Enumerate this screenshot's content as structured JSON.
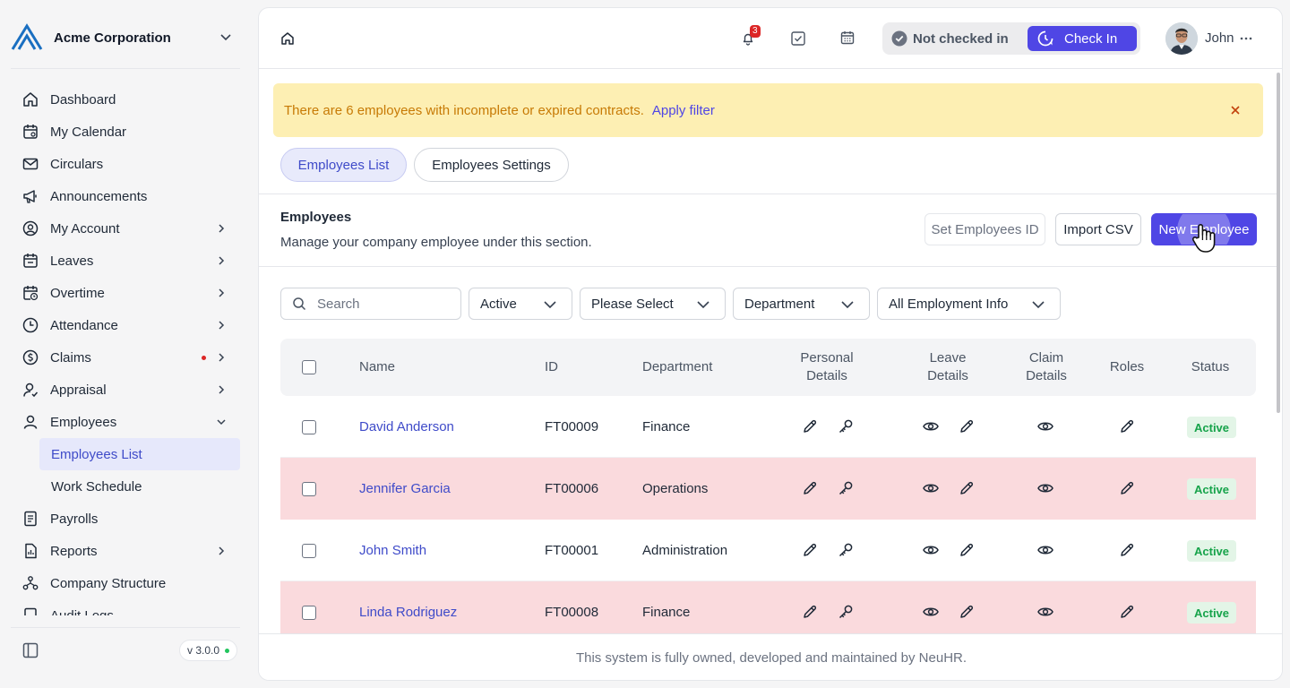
{
  "org": {
    "name": "Acme Corporation"
  },
  "sidebar": {
    "items": [
      {
        "label": "Dashboard",
        "icon": "home-icon"
      },
      {
        "label": "My Calendar",
        "icon": "calendar-icon"
      },
      {
        "label": "Circulars",
        "icon": "mail-icon"
      },
      {
        "label": "Announcements",
        "icon": "megaphone-icon"
      },
      {
        "label": "My Account",
        "icon": "user-circle-icon"
      },
      {
        "label": "Leaves",
        "icon": "calendar-leave-icon"
      },
      {
        "label": "Overtime",
        "icon": "calendar-clock-icon"
      },
      {
        "label": "Attendance",
        "icon": "clock-icon"
      },
      {
        "label": "Claims",
        "icon": "dollar-circle-icon"
      },
      {
        "label": "Appraisal",
        "icon": "user-check-icon"
      },
      {
        "label": "Employees",
        "icon": "user-icon"
      },
      {
        "label": "Payrolls",
        "icon": "receipt-icon"
      },
      {
        "label": "Reports",
        "icon": "report-icon"
      },
      {
        "label": "Company Structure",
        "icon": "structure-icon"
      },
      {
        "label": "Audit Logs",
        "icon": "log-icon"
      }
    ],
    "employees_sub": [
      {
        "label": "Employees List"
      },
      {
        "label": "Work Schedule"
      }
    ],
    "version": "v 3.0.0"
  },
  "topbar": {
    "notification_count": "3",
    "check_status": "Not checked in",
    "check_in_label": "Check In",
    "user_name": "John"
  },
  "alert": {
    "text": "There are 6 employees with incomplete or expired contracts.",
    "link": "Apply filter"
  },
  "tabs": [
    {
      "label": "Employees List",
      "active": true
    },
    {
      "label": "Employees Settings",
      "active": false
    }
  ],
  "section": {
    "title": "Employees",
    "description": "Manage your company employee under this section.",
    "buttons": {
      "set_id": "Set Employees ID",
      "import_csv": "Import CSV",
      "new_employee": "New Employee"
    }
  },
  "filters": {
    "search_placeholder": "Search",
    "status": "Active",
    "please_select": "Please Select",
    "department": "Department",
    "employment_info": "All Employment Info"
  },
  "table": {
    "headers": {
      "name": "Name",
      "id": "ID",
      "department": "Department",
      "personal": "Personal Details",
      "leave": "Leave Details",
      "claim": "Claim Details",
      "roles": "Roles",
      "status": "Status"
    },
    "rows": [
      {
        "name": "David Anderson",
        "id": "FT00009",
        "department": "Finance",
        "status": "Active",
        "highlight": false
      },
      {
        "name": "Jennifer Garcia",
        "id": "FT00006",
        "department": "Operations",
        "status": "Active",
        "highlight": true
      },
      {
        "name": "John Smith",
        "id": "FT00001",
        "department": "Administration",
        "status": "Active",
        "highlight": false
      },
      {
        "name": "Linda Rodriguez",
        "id": "FT00008",
        "department": "Finance",
        "status": "Active",
        "highlight": true
      }
    ]
  },
  "footer": {
    "text": "This system is fully owned, developed and maintained by NeuHR."
  },
  "colors": {
    "primary": "#4f46e5",
    "alert_bg": "#fdefb3",
    "alert_text": "#c77a05",
    "row_highlight": "#fadadd",
    "status_active": "#16a34a"
  }
}
